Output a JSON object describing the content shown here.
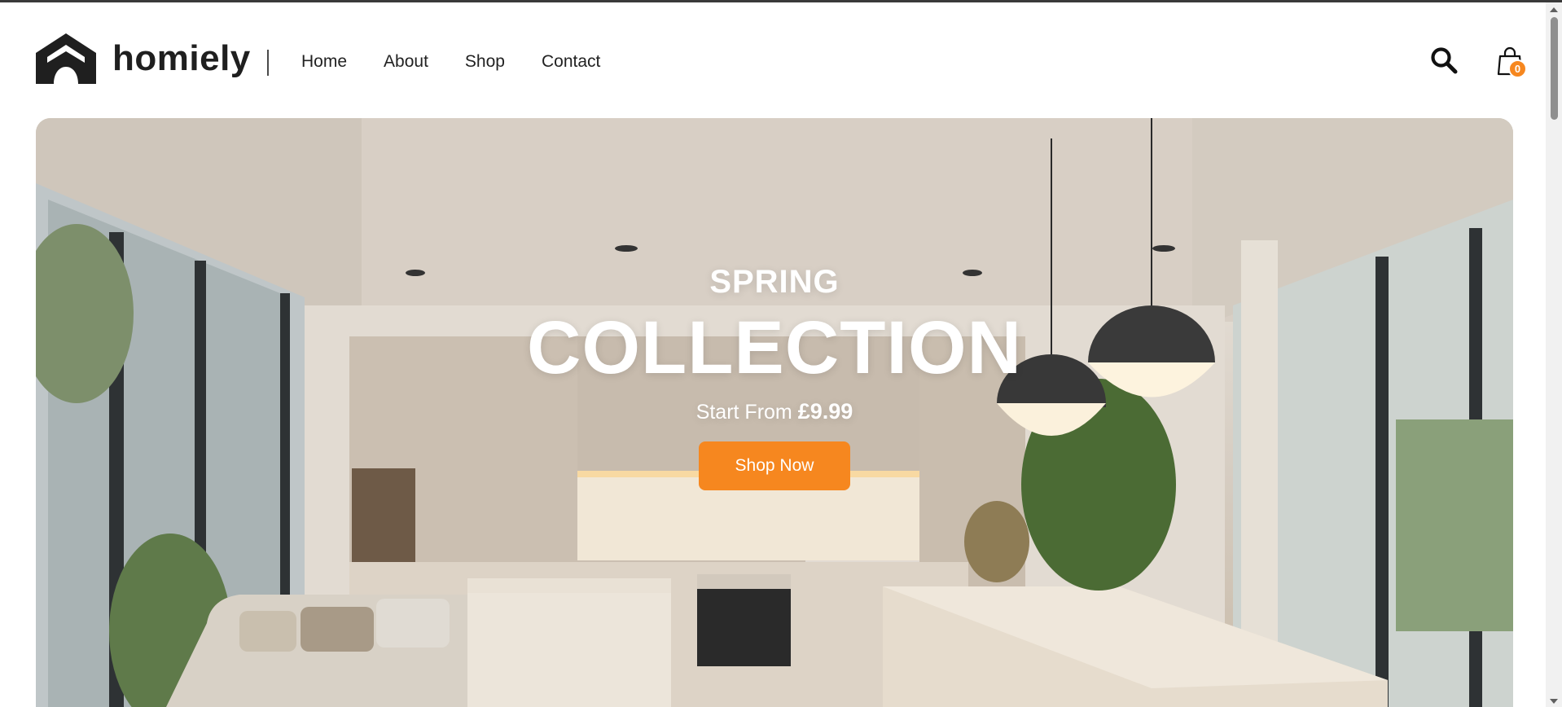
{
  "brand": {
    "name": "homiely"
  },
  "nav": {
    "items": [
      {
        "label": "Home"
      },
      {
        "label": "About"
      },
      {
        "label": "Shop"
      },
      {
        "label": "Contact"
      }
    ]
  },
  "header": {
    "search_icon": "search-icon",
    "cart_icon": "shopping-bag-icon",
    "cart_count": "0"
  },
  "hero": {
    "kicker": "SPRING",
    "title": "COLLECTION",
    "sub_prefix": "Start From",
    "price": "£9.99",
    "cta": "Shop Now"
  },
  "colors": {
    "accent": "#f6871f",
    "text_dark": "#1f1f1f",
    "hero_text": "#ffffff"
  }
}
